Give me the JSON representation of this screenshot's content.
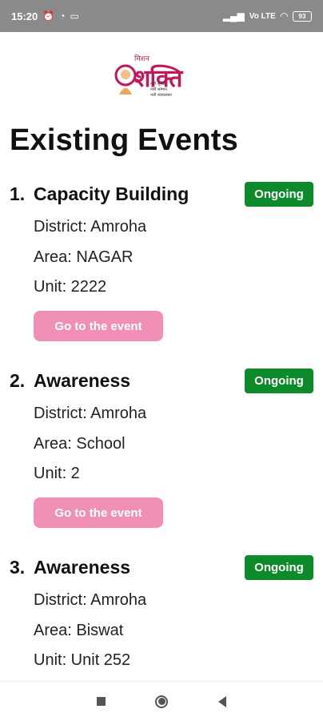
{
  "status_bar": {
    "time": "15:20",
    "network": "Vo LTE",
    "battery": "93"
  },
  "logo": {
    "top_text": "मिशन",
    "main_text": "शक्ति",
    "line1": "नारी सुरक्षा",
    "line2": "नारी सम्मान",
    "line3": "नारी स्वावलंबन"
  },
  "page_title": "Existing Events",
  "events": [
    {
      "number": "1.",
      "title": "Capacity Building",
      "status": "Ongoing",
      "district": "District: Amroha",
      "area": "Area: NAGAR",
      "unit": "Unit: 2222",
      "button_label": "Go to the event"
    },
    {
      "number": "2.",
      "title": "Awareness",
      "status": "Ongoing",
      "district": "District: Amroha",
      "area": "Area: School",
      "unit": "Unit: 2",
      "button_label": "Go to the event"
    },
    {
      "number": "3.",
      "title": "Awareness",
      "status": "Ongoing",
      "district": "District: Amroha",
      "area": "Area: Biswat",
      "unit": "Unit: Unit 252"
    }
  ],
  "colors": {
    "status_badge": "#0d8a2a",
    "event_button": "#f190b7",
    "brand": "#c2185b",
    "status_bar": "#8a8a8a"
  }
}
